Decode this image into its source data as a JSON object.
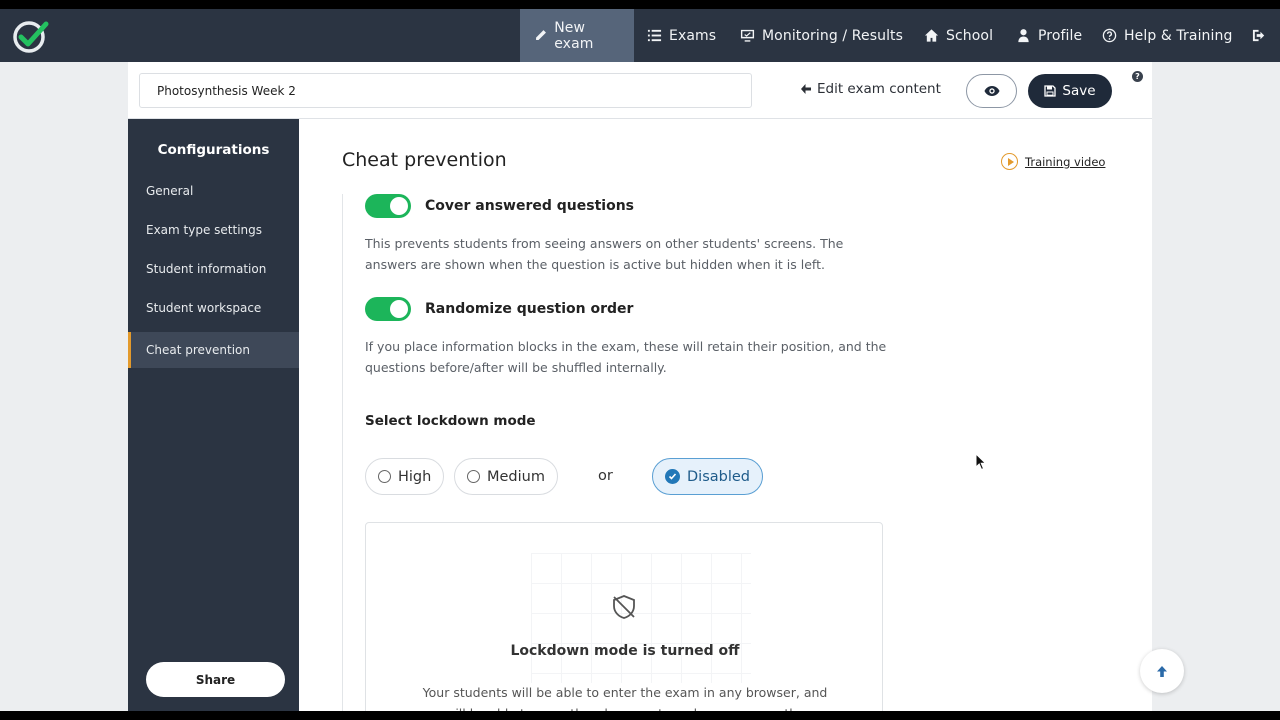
{
  "nav": {
    "items": [
      {
        "label": "New exam",
        "icon": "pencil-icon"
      },
      {
        "label": "Exams",
        "icon": "list-icon"
      },
      {
        "label": "Monitoring / Results",
        "icon": "monitor-icon"
      },
      {
        "label": "School",
        "icon": "home-icon"
      },
      {
        "label": "Profile",
        "icon": "user-icon"
      },
      {
        "label": "Help & Training",
        "icon": "question-circle-icon"
      }
    ],
    "logout_icon": "logout-icon",
    "accent": "#56657a",
    "bg": "#2b3442"
  },
  "header": {
    "exam_title_value": "Photosynthesis Week 2",
    "edit_link": "Edit exam content",
    "save_label": "Save"
  },
  "sidebar": {
    "title": "Configurations",
    "items": [
      {
        "label": "General"
      },
      {
        "label": "Exam type settings"
      },
      {
        "label": "Student information"
      },
      {
        "label": "Student workspace"
      },
      {
        "label": "Cheat prevention"
      }
    ],
    "active_index": 4,
    "share_label": "Share"
  },
  "main": {
    "title": "Cheat prevention",
    "training_link": "Training video",
    "options": [
      {
        "label": "Cover answered questions",
        "enabled": true,
        "desc": "This prevents students from seeing answers on other students' screens. The answers are shown when the question is active but hidden when it is left."
      },
      {
        "label": "Randomize question order",
        "enabled": true,
        "desc": "If you place information blocks in the exam, these will retain their position, and the questions before/after will be shuffled internally."
      }
    ],
    "lockdown": {
      "label": "Select lockdown mode",
      "modes": [
        "High",
        "Medium",
        "Disabled"
      ],
      "or_text": "or",
      "selected": "Disabled",
      "card_title": "Lockdown mode is turned off",
      "card_desc": "Your students will be able to enter the exam in any browser, and will be able to use other documents and programs on the"
    }
  },
  "colors": {
    "toggle_on": "#1cb55a",
    "selected_radio": "#2278b8",
    "sidebar_active_border": "#e39a2c",
    "save_button": "#1f2a3a"
  }
}
